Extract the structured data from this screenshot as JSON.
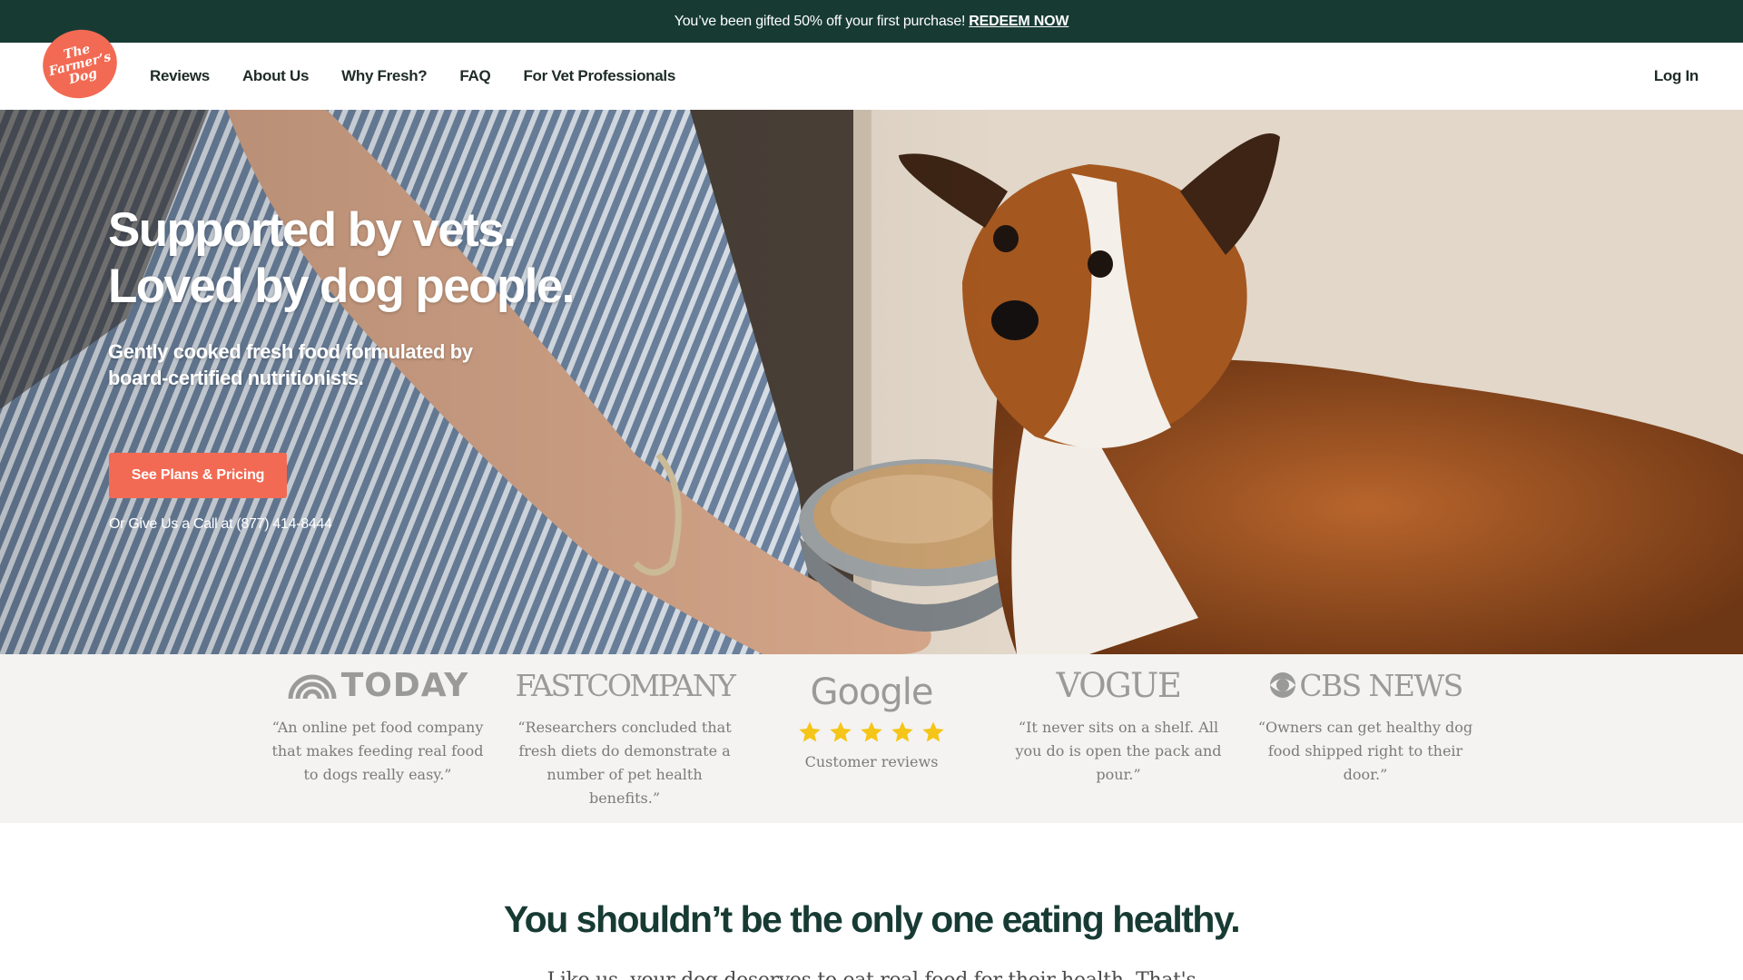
{
  "promo": {
    "text": "You’ve been gifted 50% off your first purchase!",
    "link": "REDEEM NOW"
  },
  "logo": {
    "line1": "The",
    "line2": "Farmer’s",
    "line3": "Dog"
  },
  "nav": {
    "items": [
      {
        "label": "Reviews"
      },
      {
        "label": "About Us"
      },
      {
        "label": "Why Fresh?"
      },
      {
        "label": "FAQ"
      },
      {
        "label": "For Vet Professionals"
      }
    ],
    "login": "Log In"
  },
  "hero": {
    "title_line1": "Supported by vets.",
    "title_line2": "Loved by dog people.",
    "subtitle": "Gently cooked fresh food formulated by board-certified nutritionists.",
    "cta": "See Plans & Pricing",
    "call_prefix": "Or Give Us a Call at",
    "phone": "(877) 414-8444"
  },
  "press": [
    {
      "logo": "TODAY",
      "quote": "“An online pet food company that makes feeding real food to dogs really easy.”"
    },
    {
      "logo": "FASTCOMPANY",
      "quote": "“Researchers concluded that fresh diets do demonstrate a number of pet health benefits.”"
    },
    {
      "logo": "Google",
      "rating": 5,
      "quote": "Customer reviews"
    },
    {
      "logo": "VOGUE",
      "quote": "“It never sits on a shelf. All you do is open the pack and pour.”"
    },
    {
      "logo": "CBS NEWS",
      "quote": "“Owners can get healthy dog food shipped right to their door.”"
    }
  ],
  "section": {
    "title": "You shouldn’t be the only one eating healthy.",
    "body": "Like us, your dog deserves to eat real food for their health. That's"
  },
  "colors": {
    "brand_dark": "#173b33",
    "brand_orange": "#f26a53",
    "star": "#f5c518"
  }
}
